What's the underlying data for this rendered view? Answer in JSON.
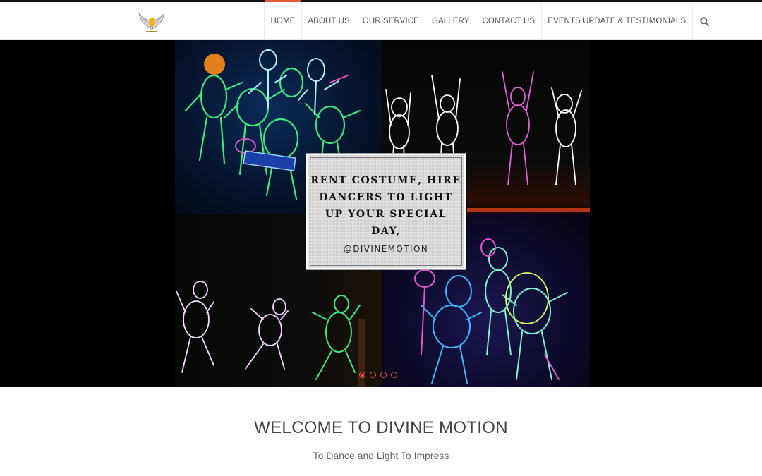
{
  "nav": {
    "items": [
      {
        "label": "HOME",
        "active": true
      },
      {
        "label": "ABOUT US",
        "active": false
      },
      {
        "label": "OUR SERVICE",
        "active": false
      },
      {
        "label": "GALLERY",
        "active": false
      },
      {
        "label": "CONTACT US",
        "active": false
      },
      {
        "label": "EVENTS UPDATE & TESTIMONIALS",
        "active": false
      }
    ],
    "search_icon": "search-icon"
  },
  "brand": {
    "logo_icon": "winged-logo-icon",
    "accent_color": "#e8593c"
  },
  "hero": {
    "caption": {
      "headline": "RENT COSTUME, HIRE DANCERS TO LIGHT UP YOUR SPECIAL DAY,",
      "handle": "@DIVINEMOTION"
    },
    "slides": [
      {
        "active": true
      },
      {
        "active": false
      },
      {
        "active": false
      },
      {
        "active": false
      }
    ]
  },
  "welcome": {
    "title": "WELCOME TO DIVINE MOTION",
    "subtitle": "To Dance and Light To Impress"
  }
}
